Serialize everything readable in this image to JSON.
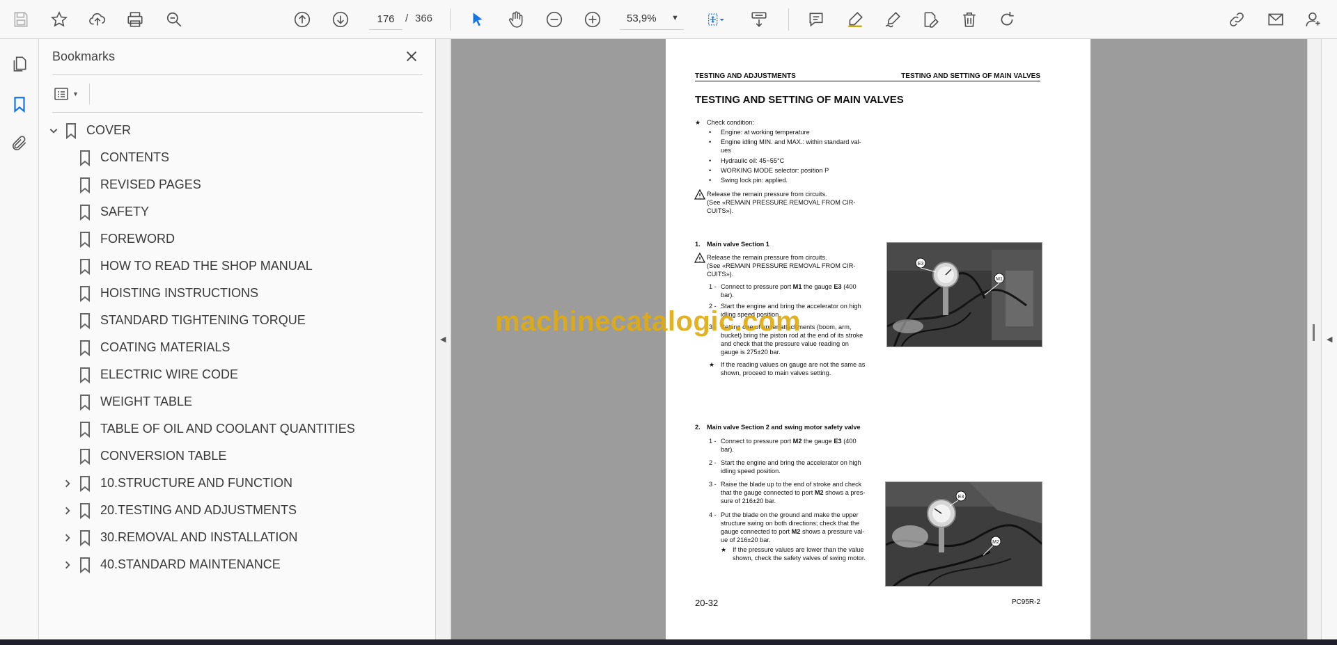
{
  "toolbar": {
    "page_current": "176",
    "page_separator": "/",
    "page_total": "366",
    "zoom": "53,9%"
  },
  "bookmarks": {
    "title": "Bookmarks",
    "items": [
      {
        "label": "COVER",
        "toggle": "expanded"
      },
      {
        "label": "CONTENTS"
      },
      {
        "label": "REVISED PAGES"
      },
      {
        "label": "SAFETY"
      },
      {
        "label": "FOREWORD"
      },
      {
        "label": "HOW TO READ THE SHOP MANUAL"
      },
      {
        "label": "HOISTING INSTRUCTIONS"
      },
      {
        "label": "STANDARD TIGHTENING TORQUE"
      },
      {
        "label": "COATING MATERIALS"
      },
      {
        "label": "ELECTRIC WIRE CODE"
      },
      {
        "label": "WEIGHT TABLE"
      },
      {
        "label": "TABLE OF OIL AND COOLANT QUANTITIES"
      },
      {
        "label": "CONVERSION TABLE"
      },
      {
        "label": "10.STRUCTURE AND FUNCTION",
        "toggle": "collapsed"
      },
      {
        "label": "20.TESTING AND ADJUSTMENTS",
        "toggle": "collapsed"
      },
      {
        "label": "30.REMOVAL AND INSTALLATION",
        "toggle": "collapsed"
      },
      {
        "label": "40.STANDARD MAINTENANCE",
        "toggle": "collapsed"
      }
    ]
  },
  "document": {
    "header_left": "TESTING AND ADJUSTMENTS",
    "header_right": "TESTING AND SETTING OF MAIN VALVES",
    "title": "TESTING AND SETTING OF MAIN VALVES",
    "check_condition": "Check condition:",
    "conditions": [
      "Engine: at working temperature",
      "Engine idling MIN. and MAX.: within standard val-",
      "ues",
      "Hydraulic oil: 45~55°C",
      "WORKING MODE selector: position P",
      "Swing lock pin: applied."
    ],
    "release_1": "Release the remain pressure from circuits.",
    "release_2": "(See «REMAIN PRESSURE REMOVAL FROM CIR-",
    "release_3": "CUITS»).",
    "section1_num": "1.",
    "section1_title": "Main valve Section 1",
    "s1_release_1": "Release the remain pressure from circuits.",
    "s1_release_2": "(See «REMAIN PRESSURE REMOVAL FROM CIR-",
    "s1_release_3": "CUITS»).",
    "s1_step1_num": "1 -",
    "s1_step1_a": "Connect to pressure port ",
    "s1_step1_b": "M1",
    "s1_step1_c": " the gauge ",
    "s1_step1_d": "E3",
    "s1_step1_e": " (400",
    "s1_step1_f": "bar).",
    "s1_step2_num": "2 -",
    "s1_step2_a": "Start the engine and bring the accelerator on high",
    "s1_step2_b": "idling speed position.",
    "s1_step3_num": "3 -",
    "s1_step3_a": "Setting one of upper attachments (boom, arm,",
    "s1_step3_b": "bucket) bring the piston rod at the end of its stroke",
    "s1_step3_c": "and check that the pressure value reading on",
    "s1_step3_d": "gauge is 275±20 bar.",
    "s1_note_a": "If the reading values on gauge are not the same as",
    "s1_note_b": "shown, proceed to main valves setting.",
    "photo1_label_a": "E3",
    "photo1_label_b": "M1",
    "section2_num": "2.",
    "section2_title": "Main valve Section 2 and swing motor safety valve",
    "s2_step1_num": "1 -",
    "s2_step1_a": "Connect to pressure port ",
    "s2_step1_b": "M2",
    "s2_step1_c": " the gauge ",
    "s2_step1_d": "E3",
    "s2_step1_e": " (400",
    "s2_step1_f": "bar).",
    "s2_step2_num": "2 -",
    "s2_step2_a": "Start the engine and bring the accelerator on high",
    "s2_step2_b": "idling speed position.",
    "s2_step3_num": "3 -",
    "s2_step3_a": "Raise the blade up to the end of stroke and check",
    "s2_step3_b1": "that the gauge connected to port ",
    "s2_step3_b2": "M2",
    "s2_step3_b3": " shows a pres-",
    "s2_step3_c": "sure of 216±20 bar.",
    "s2_step4_num": "4 -",
    "s2_step4_a": "Put the blade on the ground and make the upper",
    "s2_step4_b": "structure swing on both directions; check that the",
    "s2_step4_c1": "gauge connected to port ",
    "s2_step4_c2": "M2",
    "s2_step4_c3": " shows a pressure val-",
    "s2_step4_d": "ue of 216±20 bar.",
    "s2_note_a": "If the pressure values are lower than the value",
    "s2_note_b": "shown, check the safety valves of swing motor.",
    "photo2_label_a": "E3",
    "photo2_label_b": "M2",
    "page_number": "20-32",
    "model": "PC95R-2"
  },
  "watermark": "machinecatalogic.com",
  "colors": {
    "accent_blue": "#1473e6",
    "watermark": "#deaa14",
    "viewer_background": "#9c9c9c"
  }
}
